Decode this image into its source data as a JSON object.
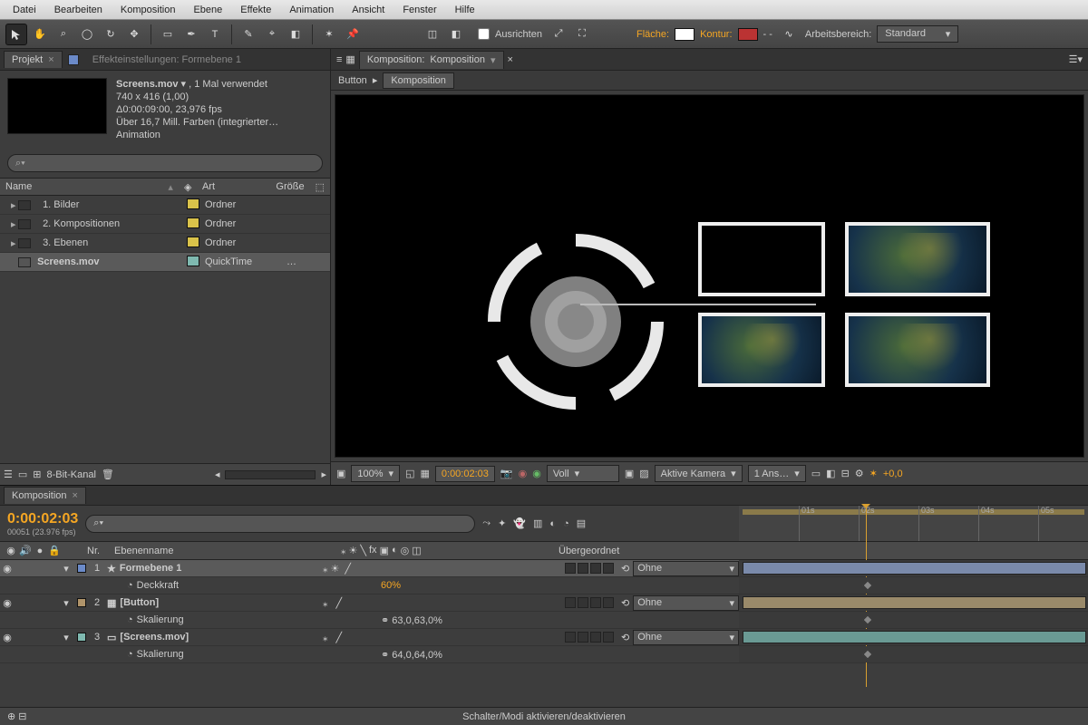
{
  "menu": [
    "Datei",
    "Bearbeiten",
    "Komposition",
    "Ebene",
    "Effekte",
    "Animation",
    "Ansicht",
    "Fenster",
    "Hilfe"
  ],
  "toolbar": {
    "align": "Ausrichten",
    "fill": "Fläche:",
    "stroke": "Kontur:",
    "stroke_px": "- -",
    "workspace_label": "Arbeitsbereich:",
    "workspace_value": "Standard"
  },
  "project": {
    "tab_project": "Projekt",
    "tab_effects": "Effekteinstellungen: Formebene 1",
    "asset_title": "Screens.mov",
    "asset_used": ", 1 Mal verwendet",
    "asset_dim": "740 x 416 (1,00)",
    "asset_dur": "Δ0:00:09:00, 23,976 fps",
    "asset_color": "Über 16,7 Mill. Farben (integrierter…",
    "asset_codec": "Animation",
    "search_icon": "⌕▾",
    "head_name": "Name",
    "head_type": "Art",
    "head_size": "Größe",
    "rows": [
      {
        "name": "1. Bilder",
        "type": "Ordner",
        "icon": "folder"
      },
      {
        "name": "2. Kompositionen",
        "type": "Ordner",
        "icon": "folder"
      },
      {
        "name": "3. Ebenen",
        "type": "Ordner",
        "icon": "folder"
      },
      {
        "name": "Screens.mov",
        "type": "QuickTime",
        "icon": "mov",
        "sel": true,
        "ell": "…"
      }
    ],
    "footer_bpc": "8-Bit-Kanal"
  },
  "comp": {
    "tab_prefix": "Komposition:",
    "tab_name": "Komposition",
    "bread1": "Button",
    "bread2": "Komposition",
    "zoom": "100%",
    "time": "0:00:02:03",
    "res": "Voll",
    "camera": "Aktive Kamera",
    "views": "1 Ans…",
    "exposure": "+0,0"
  },
  "timeline": {
    "tab": "Komposition",
    "timecode": "0:00:02:03",
    "frames": "00051 (23.976 fps)",
    "col_nr": "Nr.",
    "col_layername": "Ebenenname",
    "col_parent": "Übergeordnet",
    "ticks": [
      "01s",
      "02s",
      "03s",
      "04s",
      "05s"
    ],
    "layers": [
      {
        "idx": "1",
        "name": "Formebene 1",
        "color": "#6b8ac8",
        "parent": "Ohne",
        "sel": true,
        "props": [
          {
            "name": "Deckkraft",
            "value": "60%"
          }
        ]
      },
      {
        "idx": "2",
        "name": "[Button]",
        "color": "#b0946a",
        "parent": "Ohne",
        "props": [
          {
            "name": "Skalierung",
            "value": "63,0,63,0%"
          }
        ]
      },
      {
        "idx": "3",
        "name": "[Screens.mov]",
        "color": "#7fb9b0",
        "parent": "Ohne",
        "props": [
          {
            "name": "Skalierung",
            "value": "64,0,64,0%"
          }
        ]
      }
    ],
    "footer": "Schalter/Modi aktivieren/deaktivieren"
  },
  "icons": {
    "eye": "◉",
    "lock": "🔒",
    "star": "★",
    "link": "⟲",
    "tri_r": "▸",
    "tri_d": "▾",
    "stopwatch": "◔",
    "camera": "📷"
  }
}
